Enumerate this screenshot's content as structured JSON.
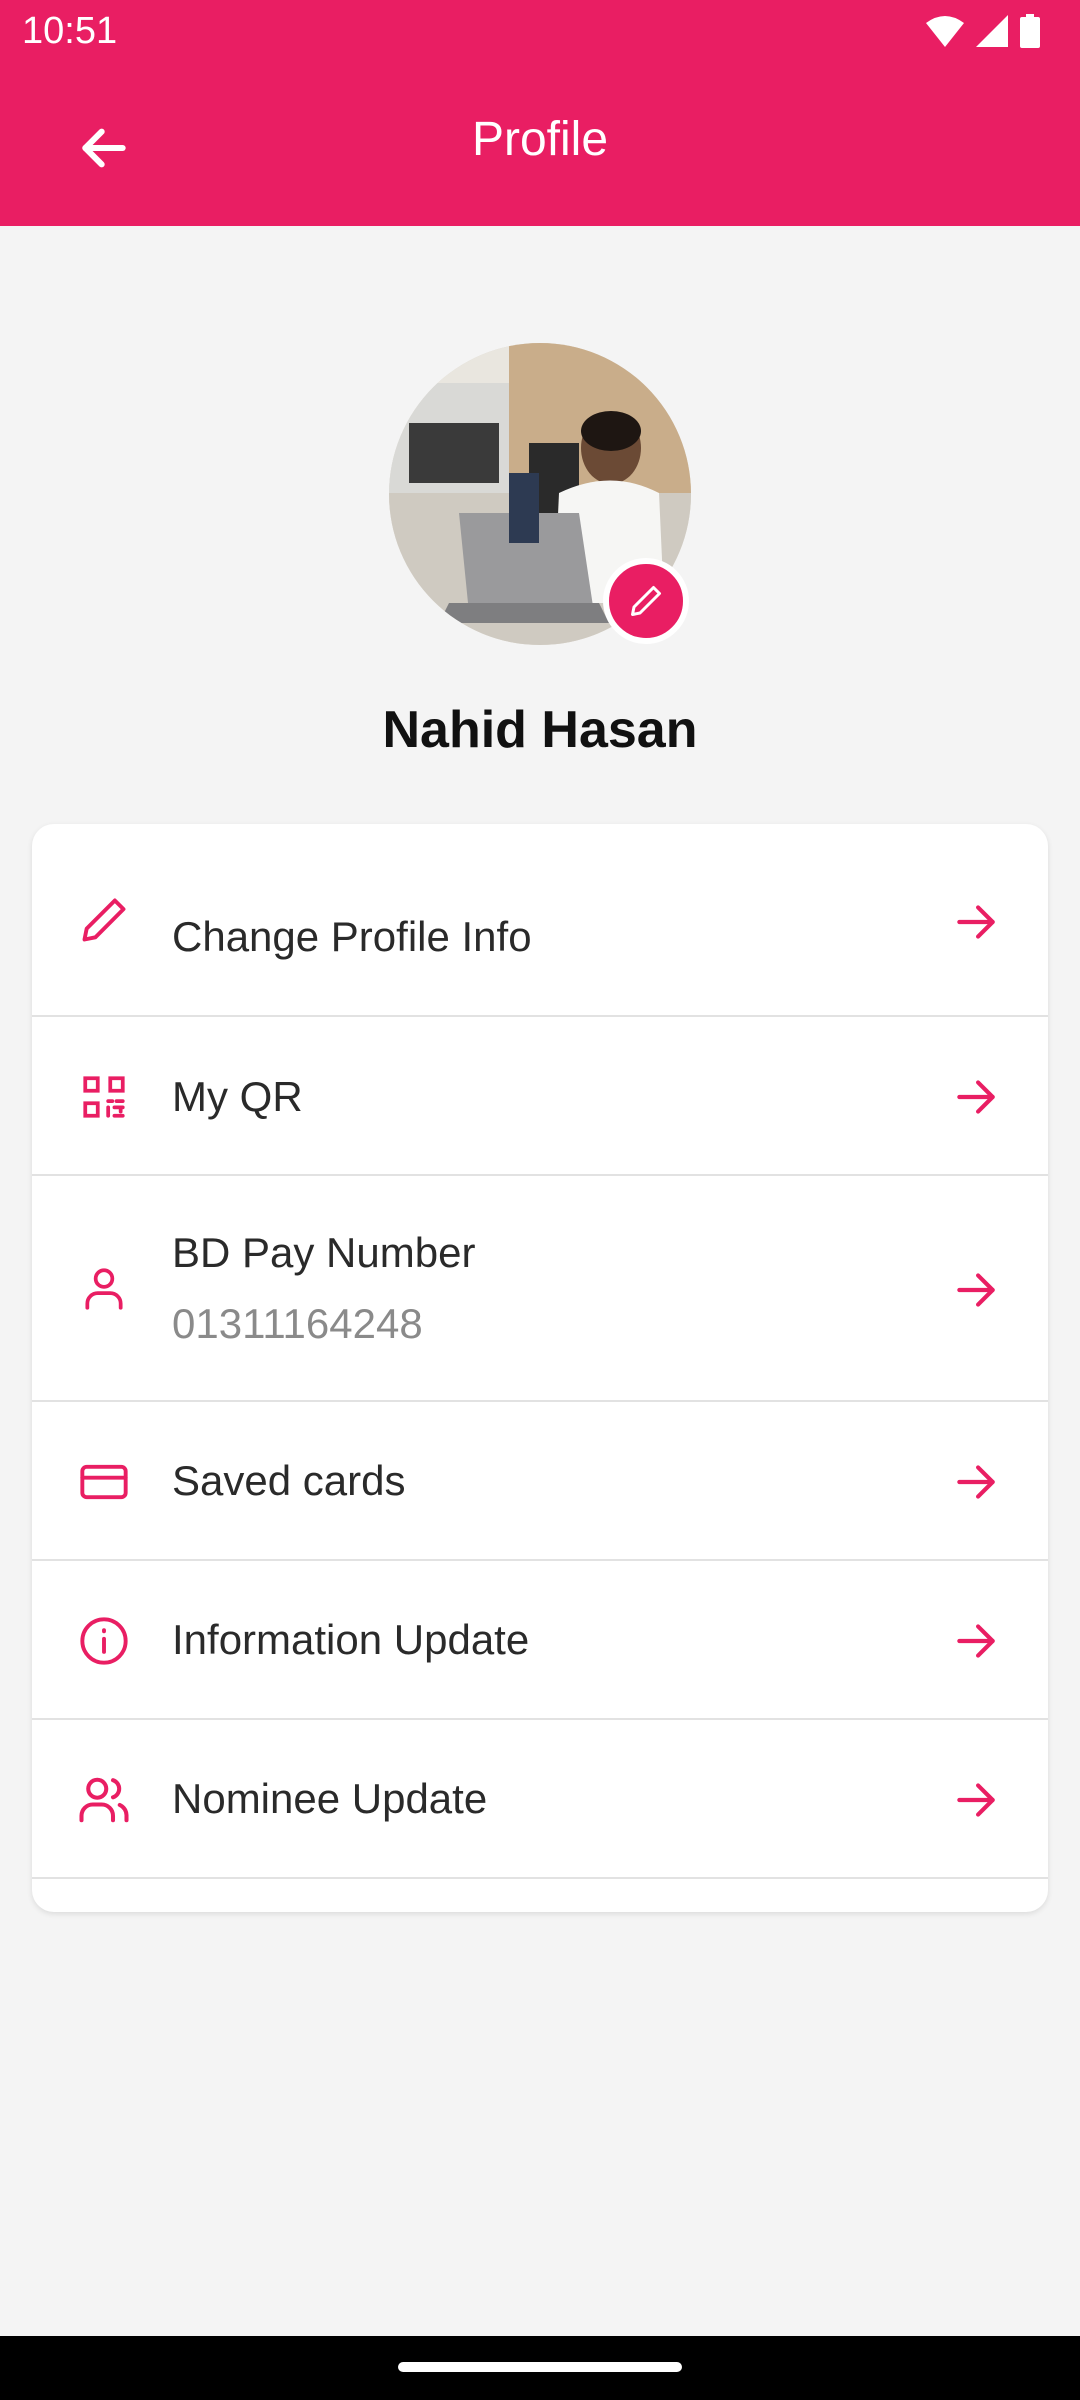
{
  "status_bar": {
    "time": "10:51"
  },
  "header": {
    "title": "Profile",
    "back_icon": "arrow-left-icon"
  },
  "profile": {
    "name": "Nahid Hasan",
    "edit_icon": "pencil-icon"
  },
  "menu": [
    {
      "label": "Change Profile Info",
      "icon": "pencil-icon"
    },
    {
      "label": "My QR",
      "icon": "qr-code-icon"
    },
    {
      "label": "BD Pay Number",
      "value": "01311164248",
      "icon": "user-icon"
    },
    {
      "label": "Saved cards",
      "icon": "credit-card-icon"
    },
    {
      "label": "Information Update",
      "icon": "info-icon"
    },
    {
      "label": "Nominee Update",
      "icon": "users-icon"
    }
  ],
  "colors": {
    "accent": "#e91e63",
    "background": "#f4f4f4",
    "card": "#ffffff"
  }
}
